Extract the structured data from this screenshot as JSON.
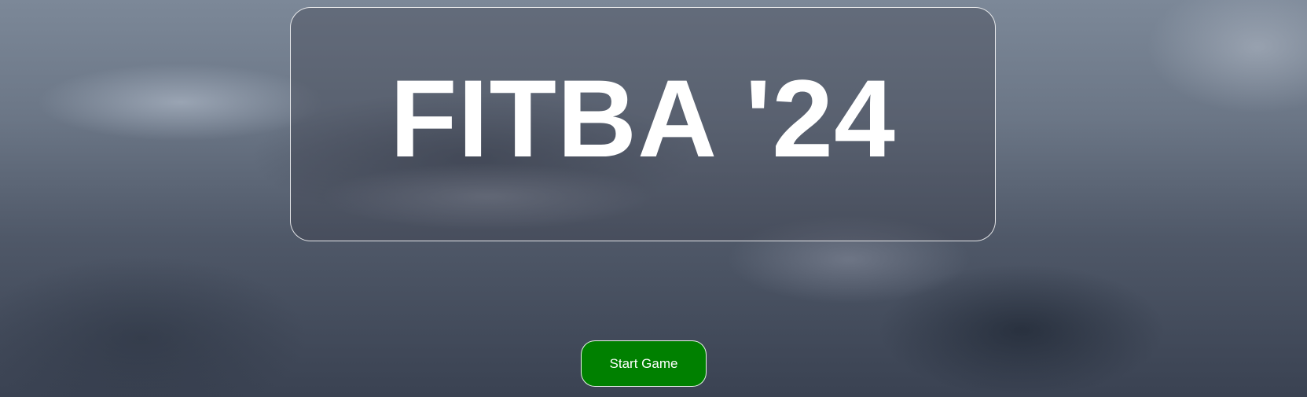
{
  "title_panel": {
    "title": "FITBA '24"
  },
  "start_button": {
    "label": "Start Game",
    "color": "#008000"
  },
  "background": {
    "description_icon": "cloudy-sky-background"
  }
}
